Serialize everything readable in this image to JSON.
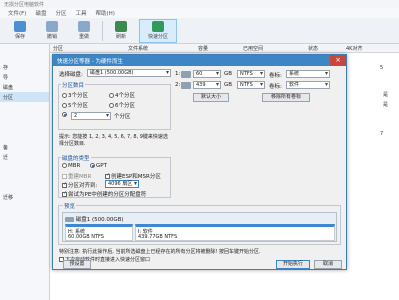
{
  "app": {
    "title": "无损分区电脑软件",
    "menus": [
      "文件(F)",
      "磁盘",
      "分区",
      "工具",
      "帮助(H)"
    ],
    "toolbar": [
      {
        "label": "保存",
        "icon": "save-icon"
      },
      {
        "label": "撤销",
        "icon": "undo-icon"
      },
      {
        "label": "重做",
        "icon": "redo-icon"
      },
      {
        "label": "刷新",
        "icon": "refresh-icon"
      },
      {
        "label": "快速分区",
        "icon": "quick-partition-icon"
      }
    ],
    "sidebar": [
      "存",
      "导",
      "磁盘",
      "分区",
      "备",
      "迁",
      "迁移"
    ],
    "grid_headers": [
      "分区",
      "文件系统",
      "容量",
      "已用空间",
      "状态",
      "4K对齐"
    ],
    "grid_cells": [
      "5",
      "是",
      "是",
      "7"
    ]
  },
  "dialog": {
    "title": "快速分区等器 - 为硬件而生",
    "close_glyph": "×",
    "select_disk_label": "选择磁盘:",
    "select_disk_value": "磁盘1 (500.00GB)",
    "count_label": "分区数目",
    "count_options": [
      "3个分区",
      "4个分区",
      "5个分区",
      "6个分区"
    ],
    "custom_option": "2",
    "custom_suffix": "个分区",
    "hint": "提示: 您能按 1, 2, 3, 4, 5, 6, 7, 8, 9键来快速选择分区数目.",
    "partitions": [
      {
        "num": "1:",
        "size": "60",
        "unit": "GB",
        "fs": "NTFS",
        "label_cap": "卷标:",
        "label": "系统"
      },
      {
        "num": "2:",
        "size": "439",
        "unit": "GB",
        "fs": "NTFS",
        "label_cap": "卷标:",
        "label": "软件"
      }
    ],
    "default_size_btn": "默认大小",
    "clear_labels_btn": "移除所有卷标",
    "disk_type_label": "磁盘的类型",
    "mbr": "MBR",
    "gpt": "GPT",
    "rebuild_mbr": "重建MBR",
    "create_esp": "创建ESP和MSR分区",
    "align": "分区对齐到:",
    "align_value": "4096 扇区",
    "search_opt": "尝试为PE中创建的分区分配盘符",
    "preview_label": "预览",
    "disk_label": "磁盘1 (500.00GB)",
    "parts_preview": [
      {
        "name": "H: 系统",
        "detail": "60.00GB NTFS"
      },
      {
        "name": "I: 软件",
        "detail": "439.77GB NTFS"
      }
    ],
    "note": "特别注意: 执行此操作后, 当前所选磁盘上已经存在的所有分区将被删除! 按回车键开始分区.",
    "no_reopen": "下次启动软件时直接进入快速分区窗口",
    "restore_btn": "预设置",
    "start_btn": "开始执行",
    "cancel_btn": "取消"
  }
}
